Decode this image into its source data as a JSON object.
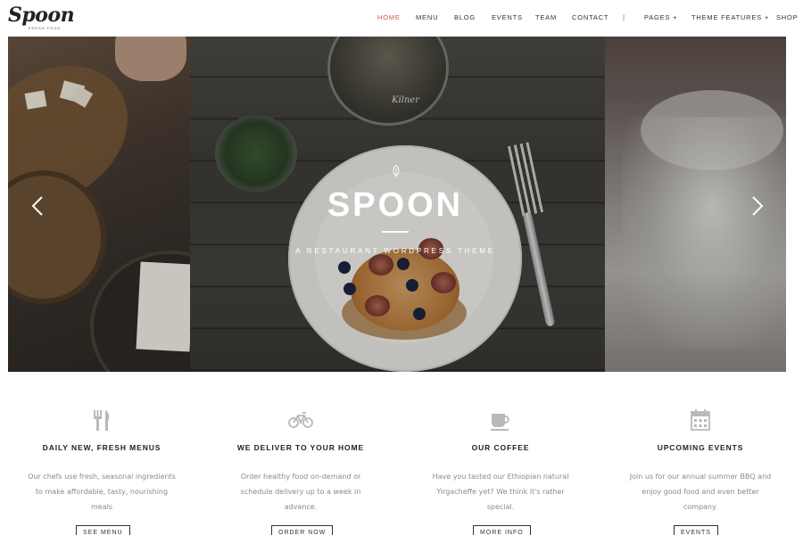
{
  "logo": {
    "name": "Spoon",
    "tagline": "Fresh Food"
  },
  "nav": {
    "items": [
      {
        "label": "HOME",
        "active": true
      },
      {
        "label": "MENU",
        "active": false
      },
      {
        "label": "BLOG",
        "active": false
      },
      {
        "label": "EVENTS",
        "active": false
      },
      {
        "label": "TEAM",
        "active": false
      },
      {
        "label": "CONTACT",
        "active": false
      }
    ],
    "separator": "|",
    "dropdowns": [
      {
        "label": "PAGES +"
      },
      {
        "label": "THEME FEATURES +"
      }
    ],
    "shop": "SHOP"
  },
  "hero": {
    "title": "SPOON",
    "subtitle": "A RESTAURANT WORDPRESS THEME",
    "jar_label": "Kilner",
    "icons": {
      "leaf": "leaf-icon",
      "prev": "chevron-left-icon",
      "next": "chevron-right-icon"
    }
  },
  "features": [
    {
      "icon": "fork-knife-icon",
      "title": "DAILY NEW, FRESH MENUS",
      "text": "Our chefs use fresh, seasonal ingredients to make affordable, tasty, nourishing meals",
      "button": "SEE MENU"
    },
    {
      "icon": "bicycle-icon",
      "title": "WE DELIVER TO YOUR HOME",
      "text": "Order healthy food on-demand or schedule delivery up to a week in advance.",
      "button": "ORDER NOW"
    },
    {
      "icon": "coffee-cup-icon",
      "title": "OUR COFFEE",
      "text": "Have you tasted our Ethiopian natural Yirgacheffe yet? We think it's rather special.",
      "button": "MORE INFO"
    },
    {
      "icon": "calendar-icon",
      "title": "UPCOMING EVENTS",
      "text": "Join us for our annual summer BBQ and enjoy good food and even better company.",
      "button": "EVENTS"
    }
  ],
  "colors": {
    "accent": "#d0563e",
    "text": "#222222",
    "muted": "#8a8a8a",
    "icon": "#b9b9b9"
  }
}
